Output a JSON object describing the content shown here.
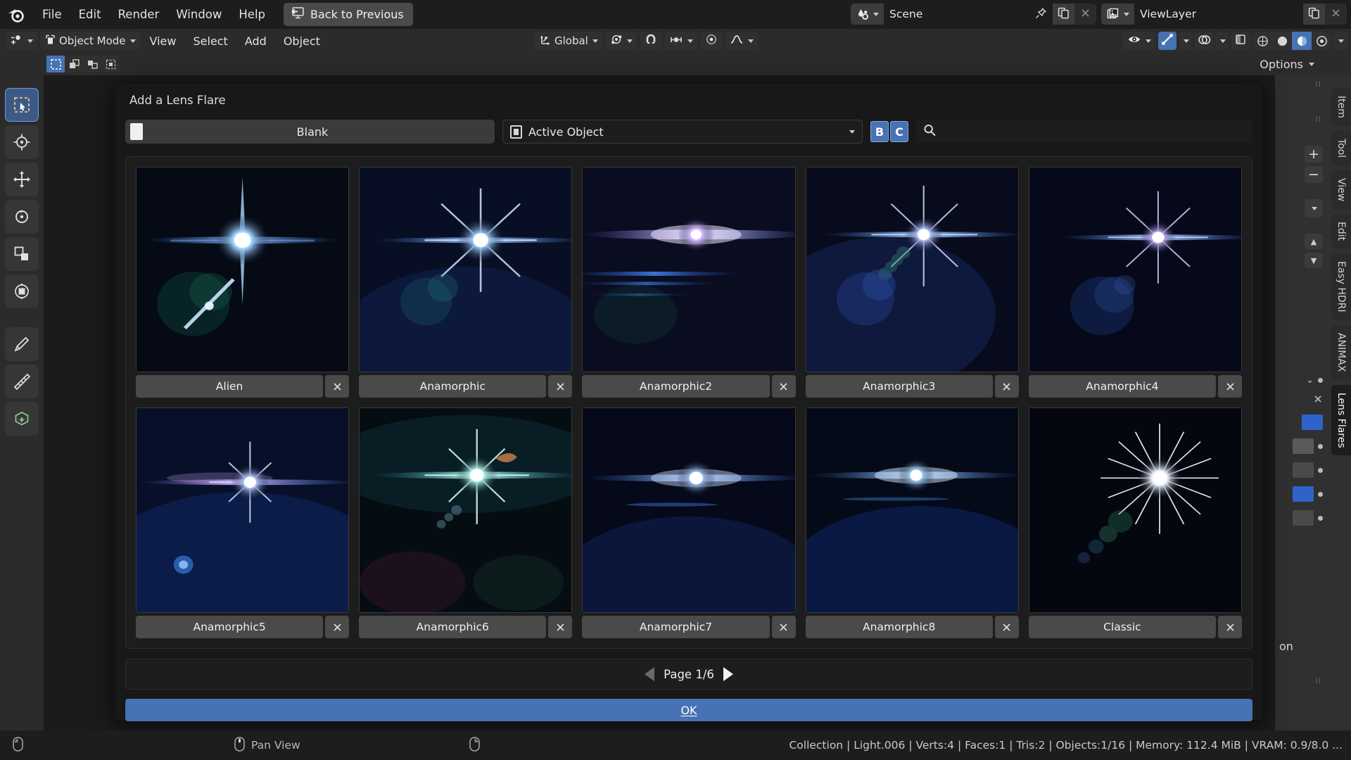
{
  "topbar": {
    "logo_icon": "blender-logo-icon",
    "menus": [
      "File",
      "Edit",
      "Render",
      "Window",
      "Help"
    ],
    "back_button": {
      "label": "Back to Previous",
      "icon": "back-to-previous-icon"
    },
    "scene": {
      "icon": "scene-data-icon",
      "name": "Scene",
      "pin_icon": "pin-icon",
      "copy_icon": "new-scene-icon",
      "close_icon": "close-icon"
    },
    "viewlayer": {
      "icon": "view-layer-icon",
      "name": "ViewLayer",
      "copy_icon": "new-view-layer-icon",
      "close_icon": "close-icon"
    }
  },
  "toolrow": {
    "editor_type_icon": "editor-type-icon",
    "mode": {
      "icon": "object-mode-icon",
      "label": "Object Mode"
    },
    "menus": [
      "View",
      "Select",
      "Add",
      "Object"
    ],
    "transform_orientation": {
      "icon": "orientation-icon",
      "label": "Global"
    },
    "snap_pivot_icon": "pivot-point-icon",
    "magnet_icon": "snap-magnet-icon",
    "snap_to_icon": "snap-to-increment-icon",
    "proportional_icon": "proportional-editing-icon",
    "falloff_icon": "proportional-falloff-icon",
    "visibility_icon": "show-hide-icon",
    "gizmo_icon": "gizmo-icon",
    "overlays_icon": "overlays-icon",
    "xray_icon": "toggle-xray-icon",
    "shading": [
      "wireframe-shading-icon",
      "solid-shading-icon",
      "material-preview-icon",
      "rendered-shading-icon"
    ],
    "shading_active_index": 2
  },
  "subrow": {
    "select_modes": [
      "tweak-select-icon",
      "box-select-icon",
      "circle-select-icon",
      "lasso-select-icon"
    ],
    "options_label": "Options"
  },
  "left_toolbar": {
    "tools": [
      "select-box-tool-icon",
      "cursor-tool-icon",
      "move-tool-icon",
      "rotate-tool-icon",
      "scale-tool-icon",
      "transform-tool-icon",
      "annotate-tool-icon",
      "measure-tool-icon",
      "add-cube-tool-icon"
    ],
    "active_index": 0
  },
  "right_panel": {
    "tabs": [
      "Item",
      "Tool",
      "View",
      "Edit",
      "Easy HDRI",
      "ANIMAX",
      "Lens Flares"
    ],
    "active_tab": "Lens Flares",
    "partial_text": "on",
    "add_icon": "plus-icon",
    "remove_icon": "minus-icon",
    "chevron_down_icon": "chevron-down-icon",
    "up_icon": "move-up-icon",
    "down_icon": "move-down-icon",
    "close_icon": "close-icon"
  },
  "dialog": {
    "title": "Add a Lens Flare",
    "preset_dropdown": {
      "label": "Blank",
      "swatch_icon": "blank-preset-icon"
    },
    "target_dropdown": {
      "label": "Active Object",
      "icon": "object-icon",
      "chevron_icon": "chevron-down-icon"
    },
    "toggle_b": "B",
    "toggle_c": "C",
    "search_icon": "search-icon",
    "delete_icon": "close-icon",
    "items": [
      {
        "name": "Alien",
        "accel": "l"
      },
      {
        "name": "Anamorphic",
        "accel": "n"
      },
      {
        "name": "Anamorphic2",
        "accel": "n"
      },
      {
        "name": "Anamorphic3",
        "accel": "n"
      },
      {
        "name": "Anamorphic4",
        "accel": "n"
      },
      {
        "name": "Anamorphic5",
        "accel": "n"
      },
      {
        "name": "Anamorphic6",
        "accel": "n"
      },
      {
        "name": "Anamorphic7",
        "accel": "n"
      },
      {
        "name": "Anamorphic8",
        "accel": "n"
      },
      {
        "name": "Classic",
        "accel": "C"
      }
    ],
    "pager": {
      "prev_icon": "page-prev-icon",
      "label": "Page 1/6",
      "next_icon": "page-next-icon"
    },
    "ok_label": "OK"
  },
  "statusbar": {
    "mouse_icon": "mouse-left-icon",
    "middle_icon": "mouse-middle-icon",
    "pan_label": "Pan View",
    "right_icon": "mouse-right-icon",
    "stats": "Collection | Light.006 | Verts:4 | Faces:1 | Tris:2 | Objects:1/16 | Memory: 112.4 MiB | VRAM: 0.9/8.0 ..."
  },
  "colors": {
    "accent": "#4772b3",
    "panel": "#303030",
    "header": "#2b2b2b",
    "background": "#1d1d1d"
  }
}
